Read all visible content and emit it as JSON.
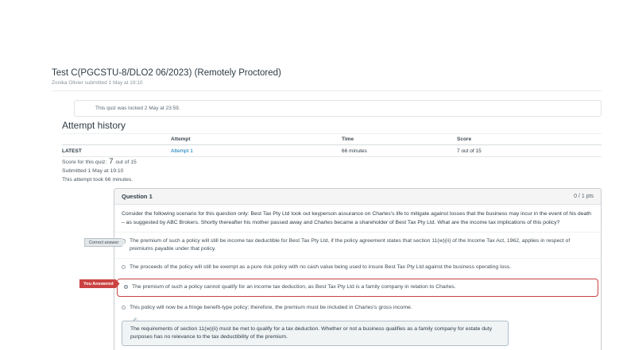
{
  "page": {
    "title": "Test C(PGCSTU-8/DLO2 06/2023) (Remotely Proctored)",
    "subtitle": "Zonika Olivier submitted 1 May at 19:10",
    "locked_notice": "This quiz was locked 2 May at 23:59.",
    "attempt_history_heading": "Attempt history"
  },
  "attempt_table": {
    "columns": {
      "attempt": "Attempt",
      "time": "Time",
      "score": "Score"
    },
    "latest_row": {
      "label": "LATEST",
      "attempt_link": "Attempt 1",
      "time": "66 minutes",
      "score": "7 out of 15"
    }
  },
  "summary": {
    "score_label": "Score for this quiz:",
    "score_value": "7",
    "score_suffix": "out of 15",
    "submitted_line": "Submitted 1 May at 19:10",
    "duration_line": "This attempt took 66 minutes."
  },
  "question": {
    "title": "Question 1",
    "points": "0 / 1 pts",
    "text": "Consider the following scenario for this question only: Best Tax Pty Ltd took out keyperson assurance on Charles's life to mitigate against losses that the business may incur in the event of his death – as suggested by ABC Brokers. Shortly thereafter his mother passed away and Charles became a shareholder of Best Tax Pty Ltd. What are the income tax implications of this policy?",
    "correct_badge": "Correct answer",
    "you_answered_badge": "You Answered",
    "options": [
      {
        "state": "correct",
        "text": "The premium of such a policy will still be income tax deductible for Best Tax Pty Ltd, if the policy agreement states that section 11(w)(ii) of the Income Tax Act, 1962, applies in respect of premiums payable under that policy."
      },
      {
        "state": "none",
        "text": "The proceeds of the policy will still be exempt as a pure risk policy with no cash value being used to insure Best Tax Pty Ltd against the business operating loss."
      },
      {
        "state": "you_answered",
        "text": "The premium of such a policy cannot qualify for an income tax deduction, as Best Tax Pty Ltd is a family company in relation to Charles."
      },
      {
        "state": "none",
        "text": "This policy will now be a fringe benefit-type policy; therefore, the premium must be included in Charles's gross income."
      }
    ],
    "explanation": "The requirements of section 11(w)(ii) must be met to qualify for a tax deduction. Whether or not a business qualifies as a family company for estate duty purposes has no relevance to the tax deductibility of the premium."
  },
  "colors": {
    "ink": "#2d3b45",
    "muted": "#8a959e",
    "link_blue": "#0374b5",
    "incorrect_red": "#ca4342",
    "card_border": "#c7cdd1",
    "question_header_bg": "#f5f5f5",
    "explanation_bg": "#f1f4f5"
  }
}
